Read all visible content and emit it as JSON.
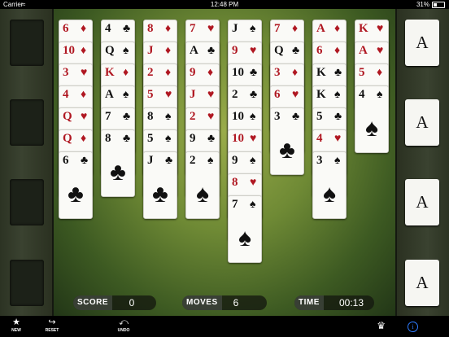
{
  "status_bar": {
    "carrier": "Carrier",
    "time": "12:48 PM",
    "battery": "31%"
  },
  "foundations": [
    "A",
    "A",
    "A",
    "A"
  ],
  "tableau": [
    [
      {
        "rank": "6",
        "suit": "♦"
      },
      {
        "rank": "10",
        "suit": "♦"
      },
      {
        "rank": "3",
        "suit": "♥"
      },
      {
        "rank": "4",
        "suit": "♦"
      },
      {
        "rank": "Q",
        "suit": "♥"
      },
      {
        "rank": "Q",
        "suit": "♦"
      },
      {
        "rank": "6",
        "suit": "♣"
      }
    ],
    [
      {
        "rank": "4",
        "suit": "♣"
      },
      {
        "rank": "Q",
        "suit": "♠"
      },
      {
        "rank": "K",
        "suit": "♦"
      },
      {
        "rank": "A",
        "suit": "♠"
      },
      {
        "rank": "7",
        "suit": "♣"
      },
      {
        "rank": "8",
        "suit": "♣"
      }
    ],
    [
      {
        "rank": "8",
        "suit": "♦"
      },
      {
        "rank": "J",
        "suit": "♦"
      },
      {
        "rank": "2",
        "suit": "♦"
      },
      {
        "rank": "5",
        "suit": "♥"
      },
      {
        "rank": "8",
        "suit": "♠"
      },
      {
        "rank": "5",
        "suit": "♠"
      },
      {
        "rank": "J",
        "suit": "♣"
      }
    ],
    [
      {
        "rank": "7",
        "suit": "♥"
      },
      {
        "rank": "A",
        "suit": "♣"
      },
      {
        "rank": "9",
        "suit": "♦"
      },
      {
        "rank": "J",
        "suit": "♥"
      },
      {
        "rank": "2",
        "suit": "♥"
      },
      {
        "rank": "9",
        "suit": "♣"
      },
      {
        "rank": "2",
        "suit": "♠"
      }
    ],
    [
      {
        "rank": "J",
        "suit": "♠"
      },
      {
        "rank": "9",
        "suit": "♥"
      },
      {
        "rank": "10",
        "suit": "♣"
      },
      {
        "rank": "2",
        "suit": "♣"
      },
      {
        "rank": "10",
        "suit": "♠"
      },
      {
        "rank": "10",
        "suit": "♥"
      },
      {
        "rank": "9",
        "suit": "♠"
      },
      {
        "rank": "8",
        "suit": "♥"
      },
      {
        "rank": "7",
        "suit": "♠"
      }
    ],
    [
      {
        "rank": "7",
        "suit": "♦"
      },
      {
        "rank": "Q",
        "suit": "♣"
      },
      {
        "rank": "3",
        "suit": "♦"
      },
      {
        "rank": "6",
        "suit": "♥"
      },
      {
        "rank": "3",
        "suit": "♣"
      }
    ],
    [
      {
        "rank": "A",
        "suit": "♦"
      },
      {
        "rank": "6",
        "suit": "♦"
      },
      {
        "rank": "K",
        "suit": "♣"
      },
      {
        "rank": "K",
        "suit": "♠"
      },
      {
        "rank": "5",
        "suit": "♣"
      },
      {
        "rank": "4",
        "suit": "♥"
      },
      {
        "rank": "3",
        "suit": "♠"
      }
    ],
    [
      {
        "rank": "K",
        "suit": "♥"
      },
      {
        "rank": "A",
        "suit": "♥"
      },
      {
        "rank": "5",
        "suit": "♦"
      },
      {
        "rank": "4",
        "suit": "♠"
      }
    ]
  ],
  "stats": {
    "score_label": "SCORE",
    "score": "0",
    "moves_label": "MOVES",
    "moves": "6",
    "time_label": "TIME",
    "time": "00:13"
  },
  "toolbar": {
    "new_label": "NEW",
    "reset_label": "RESET",
    "undo_label": "UNDO"
  },
  "colors": {
    "red_suit": "#b01822",
    "black_suit": "#111111",
    "felt": "#6f8a35",
    "info_accent": "#2e7bff"
  }
}
